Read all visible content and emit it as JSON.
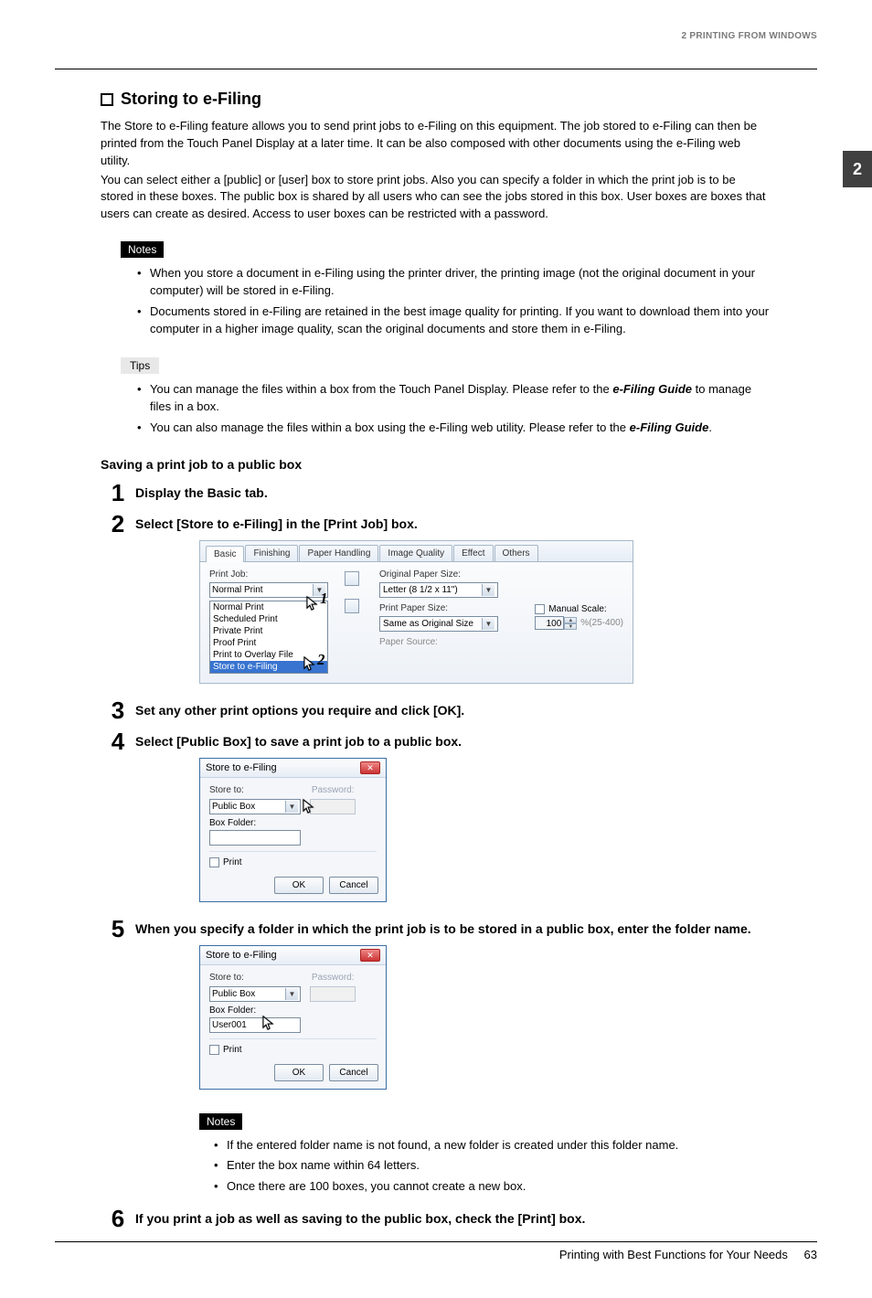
{
  "header": {
    "chapter_label": "2 PRINTING FROM WINDOWS",
    "chapter_tab": "2"
  },
  "section": {
    "title": "Storing to e-Filing",
    "intro_p1": "The Store to e-Filing feature allows you to send print jobs to e-Filing on this equipment.  The job stored to e-Filing can then be printed from the Touch Panel Display at a later time.  It can be also composed with other documents using the e-Filing web utility.",
    "intro_p2": "You can select either a [public] or [user] box to store print jobs. Also you can specify a folder in which the print job is to be stored in these boxes.  The public box is shared by all users who can see the jobs stored in this box.  User boxes are boxes that users can create as desired. Access to user boxes can be restricted with a password."
  },
  "notes": {
    "label": "Notes",
    "items": [
      "When you store a document in e-Filing using the printer driver, the printing image (not the original document in your computer) will be stored in e-Filing.",
      "Documents stored in e-Filing are retained in the best image quality for printing. If you want to download them into your computer in a higher image quality, scan the original documents and store them in e-Filing."
    ]
  },
  "tips": {
    "label": "Tips",
    "item1_a": "You can manage the files within a box from the Touch Panel Display.  Please refer to the ",
    "item1_b": "e-Filing Guide",
    "item1_c": " to manage files in a box.",
    "item2_a": "You can also manage the files within a box using the e-Filing web utility.  Please refer to the ",
    "item2_b": "e-Filing Guide",
    "item2_c": "."
  },
  "subsection": "Saving a print job to a public box",
  "steps": {
    "s1_num": "1",
    "s1_text": "Display the Basic tab.",
    "s2_num": "2",
    "s2_text": "Select [Store to e-Filing] in the [Print Job] box.",
    "s3_num": "3",
    "s3_text": "Set any other print options you require and click [OK].",
    "s4_num": "4",
    "s4_text": "Select [Public Box] to save a print job to a public box.",
    "s5_num": "5",
    "s5_text": "When you specify a folder in which the print job is to be stored in a public box, enter the folder name.",
    "s6_num": "6",
    "s6_text": "If you print a job as well as saving to the public box, check the [Print] box."
  },
  "screenshot_tabs": {
    "tabs": [
      "Basic",
      "Finishing",
      "Paper Handling",
      "Image Quality",
      "Effect",
      "Others"
    ],
    "print_job_label": "Print Job:",
    "print_job_selected": "Normal Print",
    "job_options": [
      "Normal Print",
      "Scheduled Print",
      "Private Print",
      "Proof Print",
      "Print to Overlay File",
      "Store to e-Filing"
    ],
    "original_label": "Original Paper Size:",
    "original_value": "Letter (8 1/2 x 11\")",
    "print_size_label": "Print Paper Size:",
    "print_size_value": "Same as Original Size",
    "manual_scale_label": "Manual Scale:",
    "scale_value": "100",
    "scale_range": "%(25-400)",
    "paper_source_label": "Paper Source:",
    "annot1": "1",
    "annot2": "2"
  },
  "dialog1": {
    "title": "Store to e-Filing",
    "store_to": "Store to:",
    "password": "Password:",
    "box_value": "Public Box",
    "box_folder_label": "Box Folder:",
    "box_folder_value": "",
    "print_label": "Print",
    "ok": "OK",
    "cancel": "Cancel"
  },
  "dialog2": {
    "title": "Store to e-Filing",
    "store_to": "Store to:",
    "password": "Password:",
    "box_value": "Public Box",
    "box_folder_label": "Box Folder:",
    "box_folder_value": "User001",
    "print_label": "Print",
    "ok": "OK",
    "cancel": "Cancel"
  },
  "notes2": {
    "label": "Notes",
    "items": [
      "If the entered folder name is not found, a new folder is created under this folder name.",
      "Enter the box name within 64 letters.",
      "Once there are 100 boxes, you cannot create a new box."
    ]
  },
  "footer": {
    "text": "Printing with Best Functions for Your Needs",
    "page": "63"
  }
}
